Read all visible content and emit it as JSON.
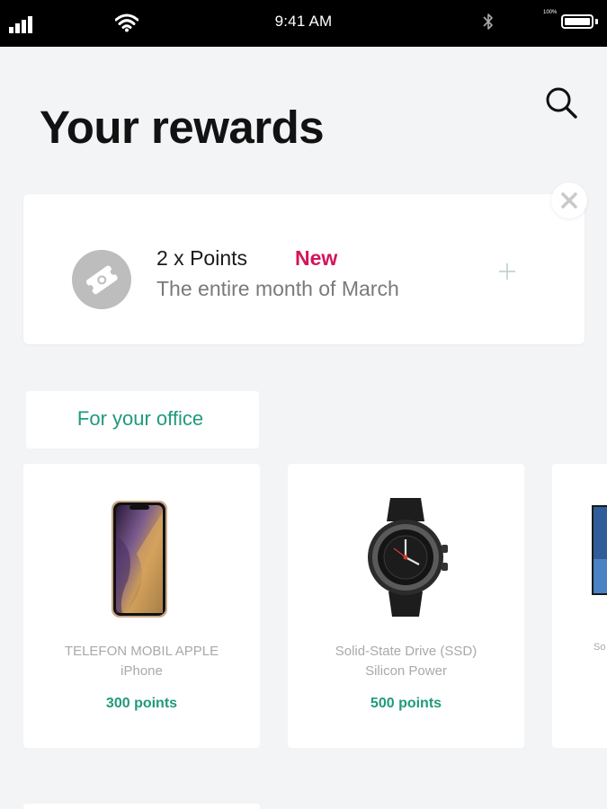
{
  "status_bar": {
    "time": "9:41 AM",
    "battery_percent_label": "100%",
    "battery_level": 1.0,
    "icons": [
      "signal-icon",
      "wifi-icon",
      "bluetooth-icon",
      "battery-icon"
    ]
  },
  "header": {
    "title": "Your rewards",
    "search_icon": "search-icon"
  },
  "promo": {
    "title": "2 x Points",
    "badge": "New",
    "subtitle": "The entire month of March",
    "icon": "ticket-icon",
    "expand_icon": "plus-icon",
    "close_icon": "close-icon"
  },
  "category": {
    "label": "For your office"
  },
  "products": [
    {
      "name_line1": "TELEFON MOBIL APPLE",
      "name_line2": "iPhone",
      "points": "300 points",
      "image": "phone-image"
    },
    {
      "name_line1": "Solid-State Drive (SSD)",
      "name_line2": "Silicon Power",
      "points": "500 points",
      "image": "smartwatch-image"
    },
    {
      "name_partial": "So",
      "image": "monitor-image"
    }
  ],
  "colors": {
    "accent": "#1f9a7c",
    "badge": "#d4145a",
    "background": "#f3f4f6"
  }
}
